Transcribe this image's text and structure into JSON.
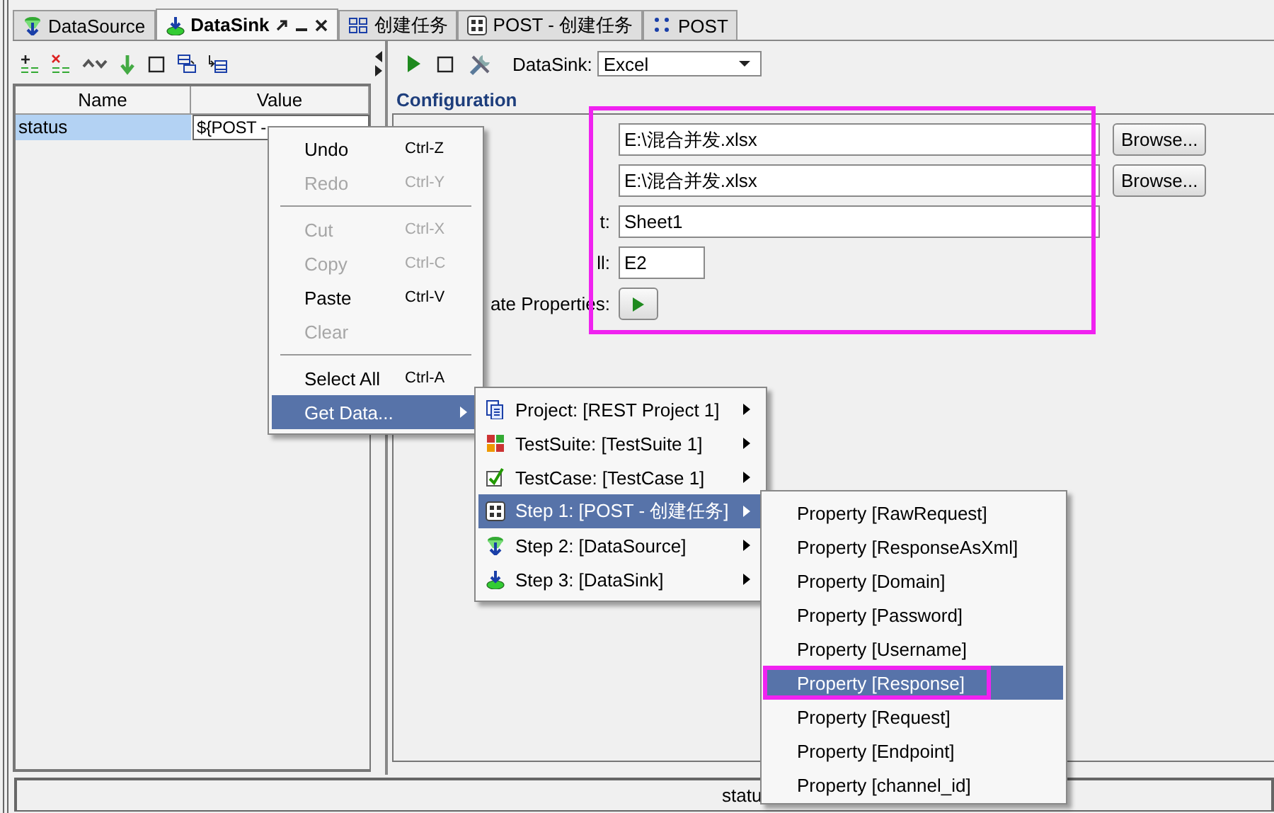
{
  "tabs": [
    {
      "label": "DataSource",
      "kind": "datasource",
      "selected": false
    },
    {
      "label": "DataSink",
      "kind": "datasink",
      "selected": true
    },
    {
      "label": "创建任务",
      "kind": "rest",
      "selected": false
    },
    {
      "label": "POST - 创建任务",
      "kind": "request",
      "selected": false
    },
    {
      "label": "POST",
      "kind": "post",
      "selected": false
    }
  ],
  "properties_table": {
    "columns": [
      "Name",
      "Value"
    ],
    "rows": [
      {
        "name": "status",
        "value": "${POST -",
        "selected": true
      }
    ]
  },
  "editor": {
    "label": "DataSink:",
    "type": "Excel",
    "heading": "Configuration",
    "annotated": true,
    "fields": [
      {
        "kind": "file",
        "value": "E:\\混合并发.xlsx",
        "button": "Browse..."
      },
      {
        "kind": "file",
        "value": "E:\\混合并发.xlsx",
        "button": "Browse..."
      },
      {
        "kind": "text",
        "label": "t:",
        "value": "Sheet1"
      },
      {
        "kind": "short",
        "label": "ll:",
        "value": "E2"
      },
      {
        "kind": "run",
        "label": "ate Properties:"
      }
    ]
  },
  "status_bar": "statu",
  "context_menu": [
    {
      "kind": "item",
      "label": "Undo",
      "shortcut": "Ctrl-Z",
      "disabled": false,
      "selected": false
    },
    {
      "kind": "item",
      "label": "Redo",
      "shortcut": "Ctrl-Y",
      "disabled": true,
      "selected": false
    },
    {
      "kind": "separator"
    },
    {
      "kind": "item",
      "label": "Cut",
      "shortcut": "Ctrl-X",
      "disabled": true,
      "selected": false
    },
    {
      "kind": "item",
      "label": "Copy",
      "shortcut": "Ctrl-C",
      "disabled": true,
      "selected": false
    },
    {
      "kind": "item",
      "label": "Paste",
      "shortcut": "Ctrl-V",
      "disabled": false,
      "selected": false
    },
    {
      "kind": "item",
      "label": "Clear",
      "disabled": true,
      "selected": false
    },
    {
      "kind": "separator"
    },
    {
      "kind": "item",
      "label": "Select All",
      "shortcut": "Ctrl-A",
      "disabled": false,
      "selected": false
    },
    {
      "kind": "submenu",
      "label": "Get Data...",
      "disabled": false,
      "selected": true
    }
  ],
  "data_menu": [
    {
      "label": "Project: [REST Project 1]",
      "kind": "project",
      "selected": false
    },
    {
      "label": "TestSuite: [TestSuite 1]",
      "kind": "testsuite",
      "selected": false
    },
    {
      "label": "TestCase: [TestCase 1]",
      "kind": "testcase",
      "selected": false
    },
    {
      "label": "Step 1: [POST - 创建任务]",
      "kind": "request",
      "selected": true
    },
    {
      "label": "Step 2: [DataSource]",
      "kind": "datasource",
      "selected": false
    },
    {
      "label": "Step 3: [DataSink]",
      "kind": "datasink",
      "selected": false
    }
  ],
  "property_menu": [
    {
      "label": "Property [RawRequest]",
      "selected": false,
      "annotated": false
    },
    {
      "label": "Property [ResponseAsXml]",
      "selected": false,
      "annotated": false
    },
    {
      "label": "Property [Domain]",
      "selected": false,
      "annotated": false
    },
    {
      "label": "Property [Password]",
      "selected": false,
      "annotated": false
    },
    {
      "label": "Property [Username]",
      "selected": false,
      "annotated": false
    },
    {
      "label": "Property [Response]",
      "selected": true,
      "annotated": true
    },
    {
      "label": "Property [Request]",
      "selected": false,
      "annotated": false
    },
    {
      "label": "Property [Endpoint]",
      "selected": false,
      "annotated": false
    },
    {
      "label": "Property [channel_id]",
      "selected": false,
      "annotated": false
    }
  ]
}
